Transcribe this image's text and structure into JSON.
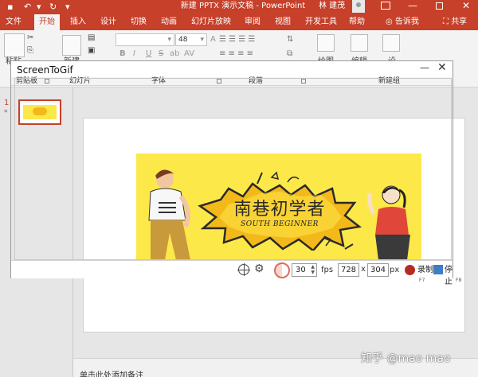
{
  "powerpoint": {
    "title": "新建 PPTX 演示文稿 - PowerPoint",
    "user": "林 建茂",
    "tabs": [
      "文件",
      "开始",
      "插入",
      "设计",
      "切换",
      "动画",
      "幻灯片放映",
      "审阅",
      "视图",
      "开发工具",
      "帮助"
    ],
    "tell_me": "告诉我",
    "share": "共享",
    "ribbon": {
      "paste": "粘贴",
      "new_slide": "新建",
      "font_size": "48",
      "font_buttons": [
        "B",
        "I",
        "U",
        "S",
        "ab",
        "AV"
      ],
      "drawing": "绘图",
      "editing": "编辑",
      "design": "设",
      "groups": [
        "剪贴板",
        "幻灯片",
        "字体",
        "段落",
        "新建组"
      ]
    },
    "slide_number": "1",
    "slide_marker": "*",
    "notes_placeholder": "单击此处添加备注"
  },
  "banner": {
    "title": "南巷初学者",
    "subtitle": "SOUTH BEGINNER"
  },
  "screentogif": {
    "title": "ScreenToGif",
    "minimize": "—",
    "close": "✕",
    "fps": "30",
    "fps_label": "fps",
    "width": "728",
    "height": "304",
    "size_separator": "x",
    "px_label": "px",
    "record_label": "录制",
    "stop_label": "停止",
    "record_hotkey": "F7",
    "stop_hotkey": "F8"
  },
  "watermark": "知乎 @mao mao",
  "colors": {
    "accent": "#c6402a",
    "banner_bg": "#fde84a",
    "burst": "#f3b81a",
    "record": "#b62b22",
    "stop": "#3d7fc6"
  }
}
